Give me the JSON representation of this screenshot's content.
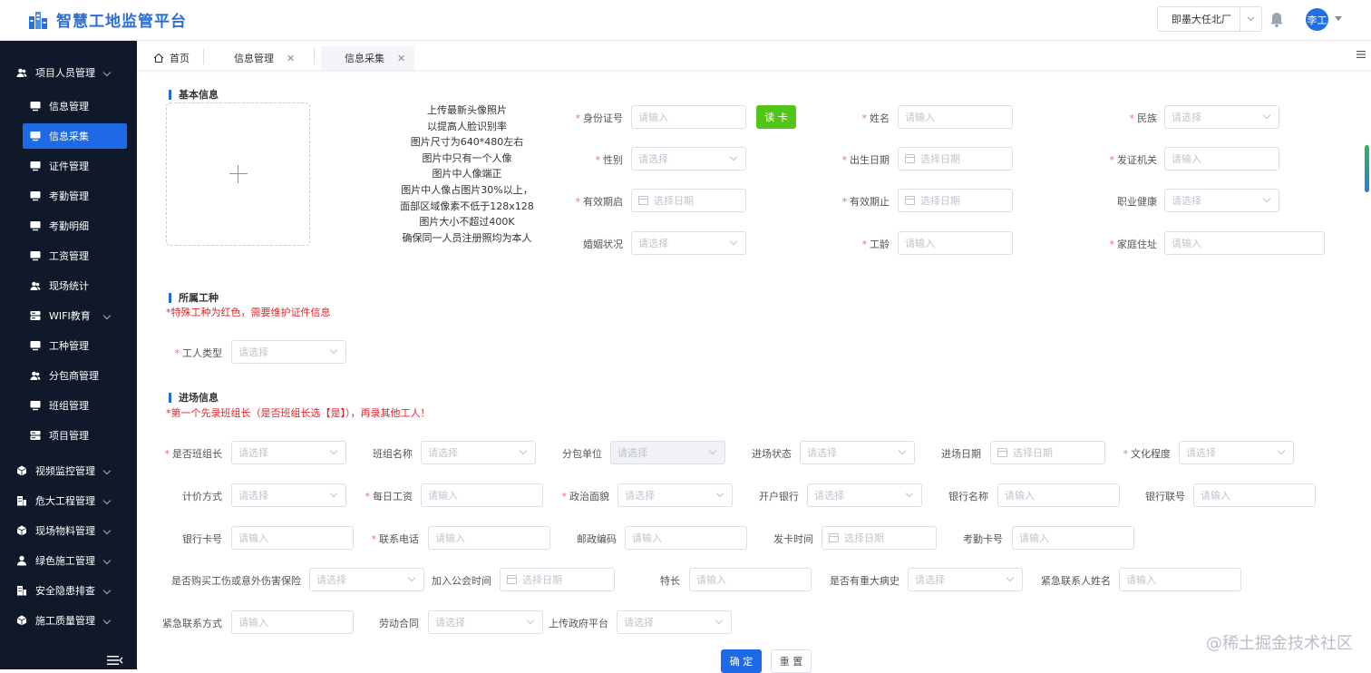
{
  "app": {
    "title": "智慧工地监管平台"
  },
  "header": {
    "site_select": "即墨大任北厂",
    "user_name": "李工"
  },
  "sidebar": {
    "items": [
      {
        "label": "项目人员管理",
        "level": 1,
        "icon": "users-icon",
        "expandable": true
      },
      {
        "label": "信息管理",
        "level": 2,
        "icon": "monitor-icon"
      },
      {
        "label": "信息采集",
        "level": 2,
        "icon": "monitor-icon",
        "active": true
      },
      {
        "label": "证件管理",
        "level": 2,
        "icon": "monitor-icon"
      },
      {
        "label": "考勤管理",
        "level": 2,
        "icon": "monitor-icon"
      },
      {
        "label": "考勤明细",
        "level": 2,
        "icon": "monitor-icon"
      },
      {
        "label": "工资管理",
        "level": 2,
        "icon": "monitor-icon"
      },
      {
        "label": "现场统计",
        "level": 2,
        "icon": "users-icon"
      },
      {
        "label": "WIFI教育",
        "level": 2,
        "icon": "server-icon",
        "expandable": true
      },
      {
        "label": "工种管理",
        "level": 2,
        "icon": "monitor-icon"
      },
      {
        "label": "分包商管理",
        "level": 2,
        "icon": "users-icon"
      },
      {
        "label": "班组管理",
        "level": 2,
        "icon": "monitor-icon"
      },
      {
        "label": "项目管理",
        "level": 2,
        "icon": "server-icon"
      },
      {
        "label": "视频监控管理",
        "level": 1,
        "icon": "cube-icon",
        "expandable": true
      },
      {
        "label": "危大工程管理",
        "level": 1,
        "icon": "building-icon",
        "expandable": true
      },
      {
        "label": "现场物料管理",
        "level": 1,
        "icon": "cube-icon",
        "expandable": true
      },
      {
        "label": "绿色施工管理",
        "level": 1,
        "icon": "user-icon",
        "expandable": true
      },
      {
        "label": "安全隐患排查",
        "level": 1,
        "icon": "building-icon",
        "expandable": true
      },
      {
        "label": "施工质量管理",
        "level": 1,
        "icon": "cube-icon",
        "expandable": true
      }
    ]
  },
  "tabs": [
    {
      "label": "首页",
      "icon": "home-icon",
      "closable": false
    },
    {
      "label": "信息管理",
      "closable": true
    },
    {
      "label": "信息采集",
      "closable": true,
      "active": true
    }
  ],
  "basic": {
    "title": "基本信息",
    "upload_tips": [
      "上传最新头像照片",
      "以提高人脸识别率",
      "图片尺寸为640*480左右",
      "图片中只有一个人像",
      "图片中人像端正",
      "图片中人像占图片30%以上，",
      "面部区域像素不低于128x128",
      "图片大小不超过400K",
      "确保同一人员注册照均为本人"
    ],
    "read_card": "读 卡",
    "fields": [
      {
        "label": "身份证号",
        "required": true,
        "type": "input",
        "placeholder": "请输入"
      },
      {
        "label": "姓名",
        "required": true,
        "type": "input",
        "placeholder": "请输入"
      },
      {
        "label": "民族",
        "required": true,
        "type": "select",
        "placeholder": "请选择"
      },
      {
        "label": "性别",
        "required": true,
        "type": "select",
        "placeholder": "请选择"
      },
      {
        "label": "出生日期",
        "required": true,
        "type": "date",
        "placeholder": "选择日期"
      },
      {
        "label": "发证机关",
        "required": true,
        "type": "input",
        "placeholder": "请输入"
      },
      {
        "label": "有效期启",
        "required": true,
        "type": "date",
        "placeholder": "选择日期"
      },
      {
        "label": "有效期止",
        "required": true,
        "type": "date",
        "placeholder": "选择日期"
      },
      {
        "label": "职业健康",
        "required": false,
        "type": "select",
        "placeholder": "请选择"
      },
      {
        "label": "婚姻状况",
        "required": false,
        "type": "select",
        "placeholder": "请选择"
      },
      {
        "label": "工龄",
        "required": true,
        "type": "input",
        "placeholder": "请输入"
      },
      {
        "label": "家庭住址",
        "required": true,
        "type": "input",
        "placeholder": "请输入"
      }
    ]
  },
  "trade": {
    "title": "所属工种",
    "note": "*特殊工种为红色，需要维护证件信息",
    "fields": [
      {
        "label": "工人类型",
        "required": true,
        "type": "select",
        "placeholder": "请选择"
      }
    ]
  },
  "entry": {
    "title": "进场信息",
    "note": "*第一个先录班组长（是否班组长选【是】），再录其他工人！",
    "fields": [
      {
        "label": "是否班组长",
        "required": true,
        "type": "select",
        "placeholder": "请选择"
      },
      {
        "label": "班组名称",
        "required": false,
        "type": "select",
        "placeholder": "请选择"
      },
      {
        "label": "分包单位",
        "required": false,
        "type": "select",
        "placeholder": "请选择",
        "disabled": true
      },
      {
        "label": "进场状态",
        "required": false,
        "type": "select",
        "placeholder": "请选择"
      },
      {
        "label": "进场日期",
        "required": false,
        "type": "date",
        "placeholder": "选择日期"
      },
      {
        "label": "文化程度",
        "required": true,
        "type": "select",
        "placeholder": "请选择"
      },
      {
        "label": "计价方式",
        "required": false,
        "type": "select",
        "placeholder": "请选择"
      },
      {
        "label": "每日工资",
        "required": true,
        "type": "input",
        "placeholder": "请输入"
      },
      {
        "label": "政治面貌",
        "required": true,
        "type": "select",
        "placeholder": "请选择"
      },
      {
        "label": "开户银行",
        "required": false,
        "type": "select",
        "placeholder": "请选择"
      },
      {
        "label": "银行名称",
        "required": false,
        "type": "input",
        "placeholder": "请输入"
      },
      {
        "label": "银行联号",
        "required": false,
        "type": "input",
        "placeholder": "请输入"
      },
      {
        "label": "银行卡号",
        "required": false,
        "type": "input",
        "placeholder": "请输入"
      },
      {
        "label": "联系电话",
        "required": true,
        "type": "input",
        "placeholder": "请输入"
      },
      {
        "label": "邮政编码",
        "required": false,
        "type": "input",
        "placeholder": "请输入"
      },
      {
        "label": "发卡时间",
        "required": false,
        "type": "date",
        "placeholder": "选择日期"
      },
      {
        "label": "考勤卡号",
        "required": false,
        "type": "input",
        "placeholder": "请输入"
      },
      {
        "label": "是否购买工伤或意外伤害保险",
        "required": false,
        "type": "select",
        "placeholder": "请选择"
      },
      {
        "label": "加入公会时间",
        "required": false,
        "type": "date",
        "placeholder": "选择日期"
      },
      {
        "label": "特长",
        "required": false,
        "type": "input",
        "placeholder": "请输入"
      },
      {
        "label": "是否有重大病史",
        "required": false,
        "type": "select",
        "placeholder": "请选择"
      },
      {
        "label": "紧急联系人姓名",
        "required": false,
        "type": "input",
        "placeholder": "请输入"
      },
      {
        "label": "紧急联系方式",
        "required": false,
        "type": "input",
        "placeholder": "请输入"
      },
      {
        "label": "劳动合同",
        "required": false,
        "type": "select",
        "placeholder": "请选择"
      },
      {
        "label": "上传政府平台",
        "required": false,
        "type": "select",
        "placeholder": "请选择"
      }
    ]
  },
  "actions": {
    "confirm": "确 定",
    "reset": "重 置"
  },
  "watermark": "@稀土掘金技术社区",
  "colors": {
    "primary": "#1e6ae6",
    "sidebar_bg": "#0f1929",
    "success": "#52c41a",
    "danger": "#e4262d"
  }
}
